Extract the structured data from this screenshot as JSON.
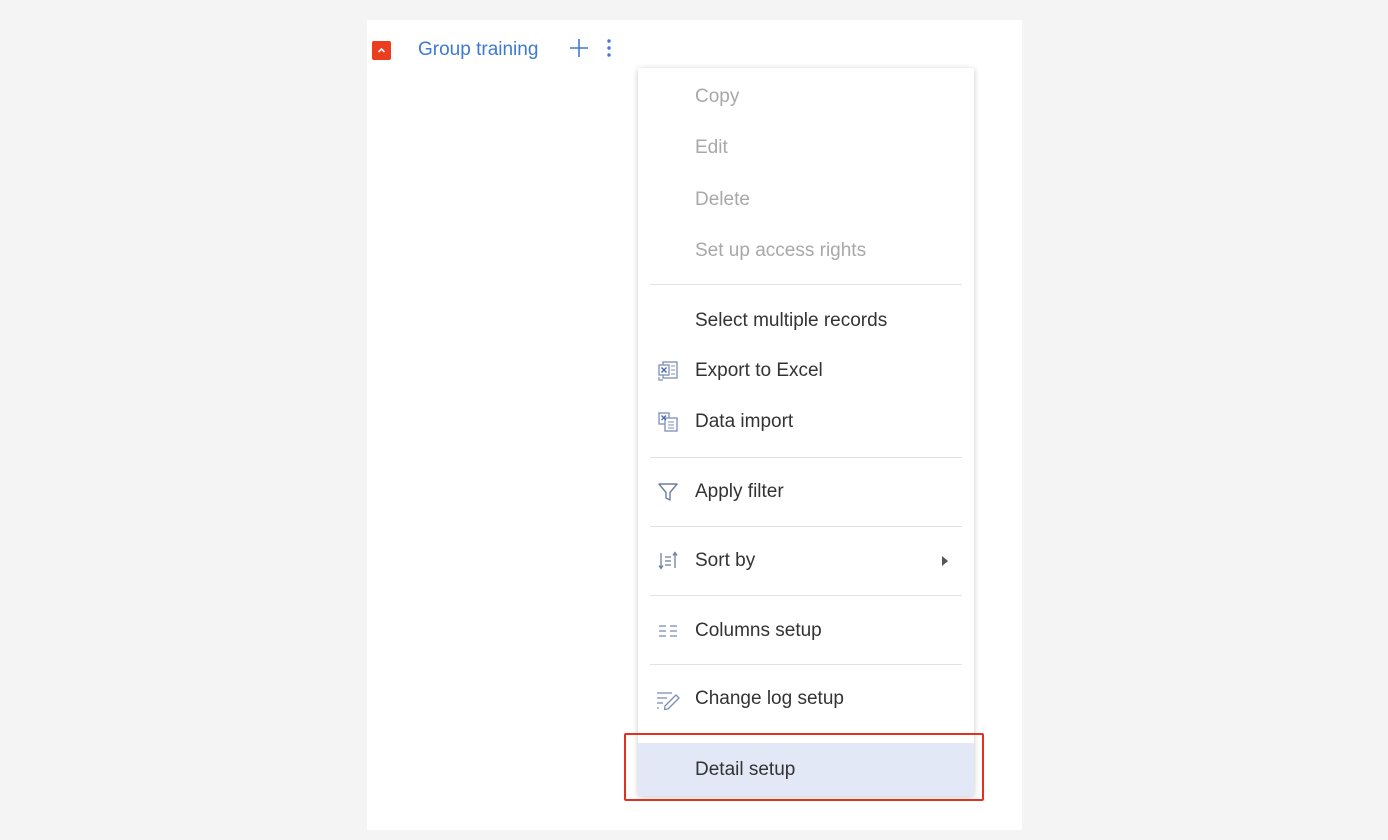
{
  "detail": {
    "title": "Group training",
    "collapse_icon": "chevron-up-icon",
    "add_icon": "plus-icon",
    "more_icon": "vertical-ellipsis-icon",
    "accent_color": "#ea3e1f",
    "link_color": "#3f79d0"
  },
  "menu": {
    "items": [
      {
        "label": "Copy",
        "enabled": false
      },
      {
        "label": "Edit",
        "enabled": false
      },
      {
        "label": "Delete",
        "enabled": false
      },
      {
        "label": "Set up access rights",
        "enabled": false
      },
      {
        "label": "Select multiple records",
        "enabled": true
      },
      {
        "label": "Export to Excel",
        "enabled": true,
        "icon": "excel-export-icon"
      },
      {
        "label": "Data import",
        "enabled": true,
        "icon": "data-import-icon"
      },
      {
        "label": "Apply filter",
        "enabled": true,
        "icon": "filter-icon"
      },
      {
        "label": "Sort by",
        "enabled": true,
        "icon": "sort-icon",
        "has_submenu": true
      },
      {
        "label": "Columns setup",
        "enabled": true,
        "icon": "columns-icon"
      },
      {
        "label": "Change log setup",
        "enabled": true,
        "icon": "change-log-icon"
      },
      {
        "label": "Detail setup",
        "enabled": true,
        "highlighted": true
      }
    ],
    "highlight_color": "#e0321f"
  }
}
